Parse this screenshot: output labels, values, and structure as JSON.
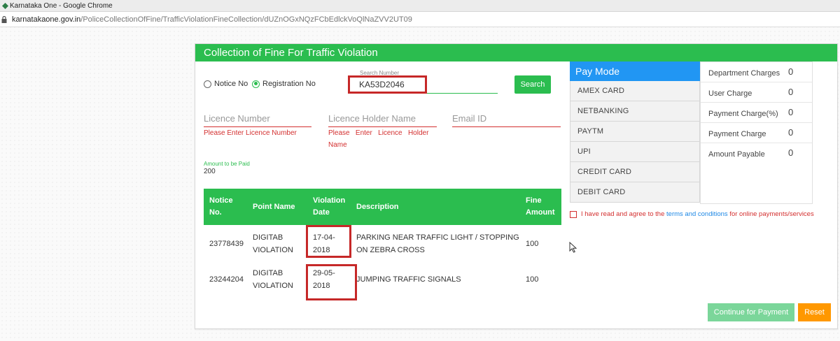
{
  "window": {
    "title": "Karnataka One - Google Chrome"
  },
  "address": {
    "host": "karnatakaone.gov.in",
    "path": "/PoliceCollectionOfFine/TrafficViolationFineCollection/dUZnOGxNQzFCbEdlckVoQlNaZVV2UT09"
  },
  "page": {
    "heading": "Collection of Fine For Traffic Violation"
  },
  "search": {
    "option_notice": "Notice No",
    "option_registration": "Registration No",
    "selected": "Registration No",
    "label": "Search Number",
    "value": "KA53D2046",
    "button": "Search"
  },
  "fields": {
    "licence_number": {
      "placeholder": "Licence Number",
      "error": "Please Enter Licence Number"
    },
    "holder_name": {
      "placeholder": "Licence Holder Name",
      "error_line1": "Please   Enter   Licence   Holder",
      "error_line2": "Name"
    },
    "email": {
      "placeholder": "Email ID"
    }
  },
  "amount": {
    "label": "Amount to be Paid",
    "value": "200"
  },
  "table": {
    "headers": {
      "notice_1": "Notice",
      "notice_2": "No.",
      "point": "Point Name",
      "date_1": "Violation",
      "date_2": "Date",
      "description": "Description",
      "fine_1": "Fine",
      "fine_2": "Amount"
    },
    "rows": [
      {
        "notice": "23778439",
        "point_1": "DIGITAB",
        "point_2": "VIOLATION",
        "date_1": "17-04-",
        "date_2": "2018",
        "desc_1": "PARKING NEAR TRAFFIC LIGHT / STOPPING",
        "desc_2": "ON ZEBRA CROSS",
        "fine": "100"
      },
      {
        "notice": "23244204",
        "point_1": "DIGITAB",
        "point_2": "VIOLATION",
        "date_1": "29-05-",
        "date_2": "2018",
        "desc_1": "JUMPING TRAFFIC SIGNALS",
        "desc_2": "",
        "fine": "100"
      }
    ]
  },
  "paymode": {
    "heading": "Pay Mode",
    "options": [
      "AMEX CARD",
      "NETBANKING",
      "PAYTM",
      "UPI",
      "CREDIT CARD",
      "DEBIT CARD"
    ]
  },
  "charges": [
    {
      "label": "Department Charges",
      "value": "0"
    },
    {
      "label": "User Charge",
      "value": "0"
    },
    {
      "label": "Payment Charge(%)",
      "value": "0"
    },
    {
      "label": "Payment Charge",
      "value": "0"
    },
    {
      "label": "Amount Payable",
      "value": "0"
    }
  ],
  "agreement": {
    "prefix": "I have read and agree to the ",
    "link": "terms and conditions",
    "suffix": " for online payments/services"
  },
  "buttons": {
    "continue": "Continue for Payment",
    "reset": "Reset"
  },
  "colors": {
    "green": "#2bbd4f",
    "blue": "#2196f3",
    "orange": "#ff9800",
    "highlight_red": "#c62828",
    "error_red": "#d32f2f"
  }
}
